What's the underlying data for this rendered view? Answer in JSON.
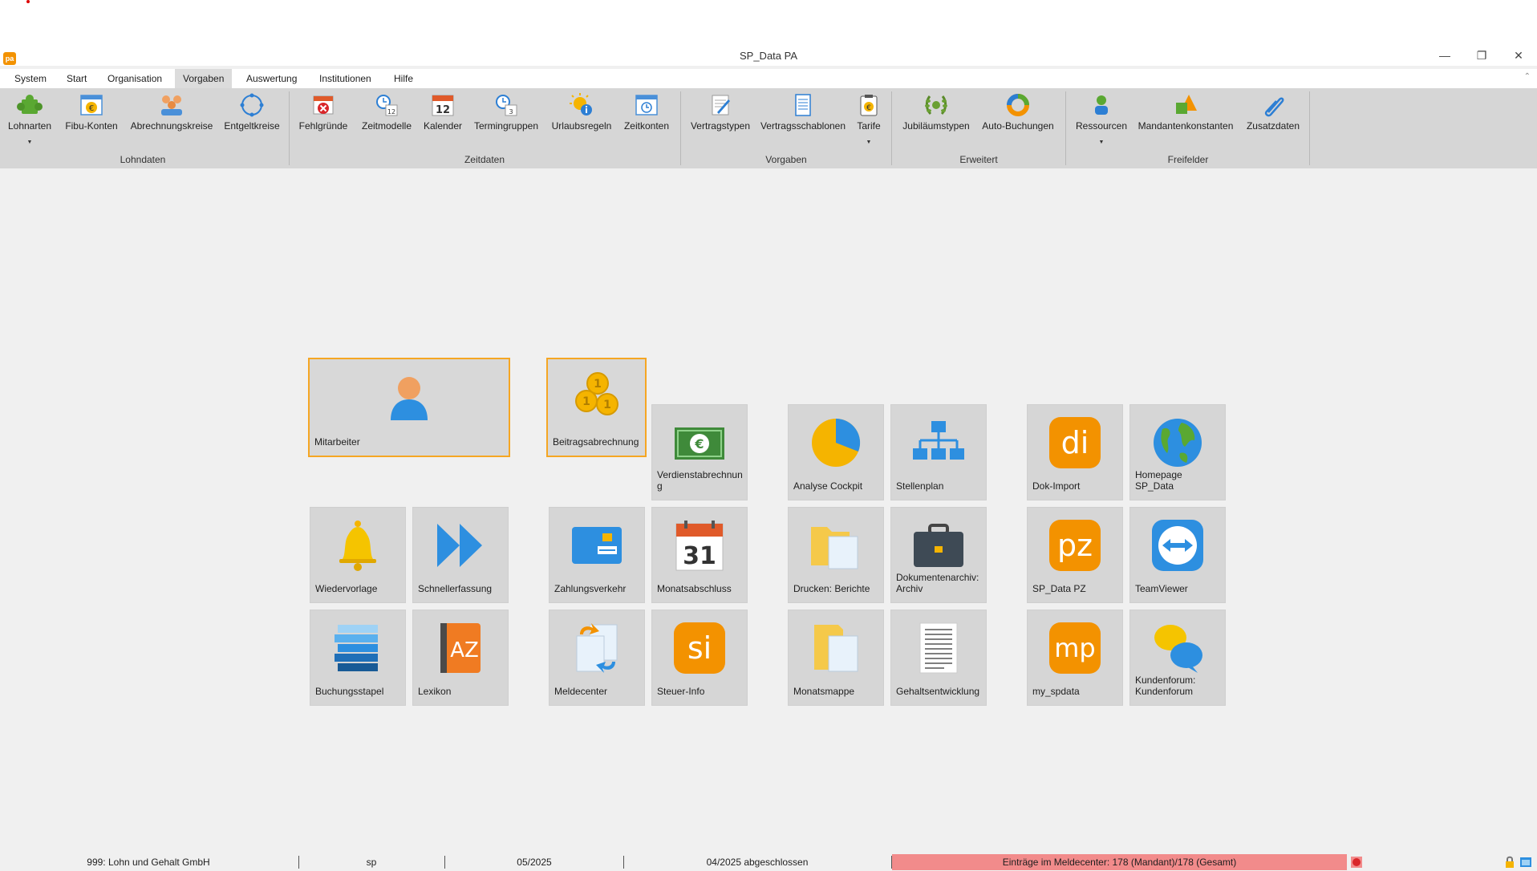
{
  "window": {
    "title": "SP_Data PA",
    "logo_text": "pa",
    "minimize": "—",
    "restore": "❐",
    "close": "✕"
  },
  "menu": [
    "System",
    "Start",
    "Organisation",
    "Vorgaben",
    "Auswertung",
    "Institutionen",
    "Hilfe"
  ],
  "menu_active": "Vorgaben",
  "ribbon": {
    "groups": {
      "lohndaten": "Lohndaten",
      "zeitdaten": "Zeitdaten",
      "vorgaben": "Vorgaben",
      "erweitert": "Erweitert",
      "freifelder": "Freifelder"
    },
    "buttons": {
      "lohnarten": "Lohnarten",
      "fibu": "Fibu-Konten",
      "abrechnungskreise": "Abrechnungskreise",
      "entgeltkreise": "Entgeltkreise",
      "fehlgruende": "Fehlgründe",
      "zeitmodelle": "Zeitmodelle",
      "kalender": "Kalender",
      "termingruppen": "Termingruppen",
      "urlaubsregeln": "Urlaubsregeln",
      "zeitkonten": "Zeitkonten",
      "vertragstypen": "Vertragstypen",
      "vertragsschablonen": "Vertragsschablonen",
      "tarife": "Tarife",
      "jubilaeumstypen": "Jubiläumstypen",
      "autobuchungen": "Auto-Buchungen",
      "ressourcen": "Ressourcen",
      "mandantenkonstanten": "Mandantenkonstanten",
      "zusatzdaten": "Zusatzdaten"
    },
    "kalender_day": "12",
    "zeitmodelle_num": "12",
    "termingruppen_num": "3"
  },
  "tiles": {
    "mitarbeiter": "Mitarbeiter",
    "beitragsabrechnung": "Beitragsabrechnung",
    "verdienstabrechnung": "Verdienstabrechnun g",
    "analyse": "Analyse Cockpit",
    "stellenplan": "Stellenplan",
    "dokimport": "Dok-Import",
    "homepage": "Homepage SP_Data",
    "wiedervorlage": "Wiedervorlage",
    "schnellerfassung": "Schnellerfassung",
    "zahlungsverkehr": "Zahlungsverkehr",
    "monatsabschluss": "Monatsabschluss",
    "drucken": "Drucken: Berichte",
    "dokumentenarchiv": "Dokumentenarchiv: Archiv",
    "spdatapz": "SP_Data PZ",
    "teamviewer": "TeamViewer",
    "buchungsstapel": "Buchungsstapel",
    "lexikon": "Lexikon",
    "meldecenter": "Meldecenter",
    "steuerinfo": "Steuer-Info",
    "monatsmappe": "Monatsmappe",
    "gehaltsentwicklung": "Gehaltsentwicklung",
    "myspdata": "my_spdata",
    "kundenforum": "Kundenforum: Kundenforum"
  },
  "tile_icons": {
    "dokimport": "di",
    "spdatapz": "pz",
    "steuerinfo": "si",
    "myspdata": "mp",
    "calendar_day": "31",
    "lexikon": "AZ"
  },
  "status": {
    "mandant": "999: Lohn und Gehalt GmbH",
    "user": "sp",
    "period": "05/2025",
    "closed": "04/2025 abgeschlossen",
    "meldecenter": "Einträge im Meldecenter: 178 (Mandant)/178 (Gesamt)"
  },
  "colors": {
    "accent": "#f39200",
    "selection": "#f5a623",
    "alert": "#f28b8b",
    "ribbon": "#d6d6d6"
  }
}
